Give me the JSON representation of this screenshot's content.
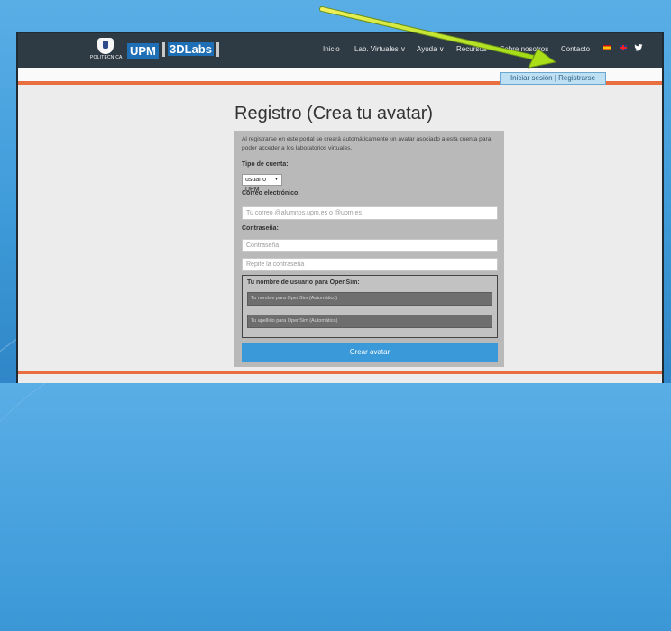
{
  "logo": {
    "caption": "POLITÉCNICA",
    "upm": "UPM",
    "threed": "3DLabs"
  },
  "nav": {
    "items": [
      {
        "label": "Inicio"
      },
      {
        "label": "Lab. Virtuales ∨"
      },
      {
        "label": "Ayuda ∨"
      },
      {
        "label": "Recursos"
      },
      {
        "label": "Sobre nosotros"
      },
      {
        "label": "Contacto"
      }
    ],
    "login_label": "Iniciar sesión | Registrarse"
  },
  "page": {
    "title": "Registro (Crea tu avatar)"
  },
  "form": {
    "intro": "Al registrarse en este portal se creará automáticamente un avatar asociado a esta cuenta para poder acceder a los laboratorios virtuales.",
    "account_type_label": "Tipo de cuenta:",
    "account_type_value": "usuario UPM",
    "email_label": "Correo electrónico:",
    "email_placeholder": "Tu correo @alumnos.upm.es o @upm.es",
    "password_label": "Contraseña:",
    "password_placeholder": "Contraseña",
    "password_repeat_placeholder": "Repite la contraseña",
    "opensim_label": "Tu nombre de usuario para OpenSim:",
    "opensim_first_placeholder": "Tu nombre para OpenSim (Automático)",
    "opensim_last_placeholder": "Tu apellido para OpenSim (Automático)",
    "submit_label": "Crear avatar"
  },
  "colors": {
    "navbar": "#2e3a44",
    "accent_orange": "#e86e3f",
    "button_blue": "#3a9ad9",
    "annotation_arrow": "#b7e61c"
  },
  "icons": {
    "flag_spain": "flag-es-icon",
    "flag_uk": "flag-uk-icon",
    "twitter": "twitter-icon"
  }
}
